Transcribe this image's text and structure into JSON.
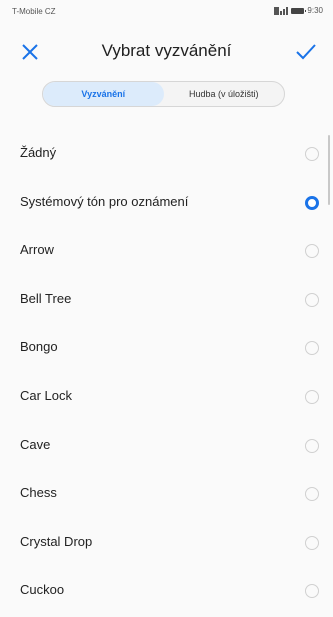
{
  "status_bar": {
    "carrier": "T-Mobile CZ",
    "time": "9:30"
  },
  "header": {
    "title": "Vybrat vyzvánění",
    "close_icon": "close-icon",
    "confirm_icon": "check-icon"
  },
  "tabs": [
    {
      "label": "Vyzvánění",
      "active": true
    },
    {
      "label": "Hudba (v úložišti)",
      "active": false
    }
  ],
  "ringtones": [
    {
      "label": "Žádný",
      "selected": false
    },
    {
      "label": "Systémový tón pro oznámení",
      "selected": true
    },
    {
      "label": "Arrow",
      "selected": false
    },
    {
      "label": "Bell Tree",
      "selected": false
    },
    {
      "label": "Bongo",
      "selected": false
    },
    {
      "label": "Car Lock",
      "selected": false
    },
    {
      "label": "Cave",
      "selected": false
    },
    {
      "label": "Chess",
      "selected": false
    },
    {
      "label": "Crystal Drop",
      "selected": false
    },
    {
      "label": "Cuckoo",
      "selected": false
    }
  ],
  "colors": {
    "accent": "#1a73e8"
  }
}
